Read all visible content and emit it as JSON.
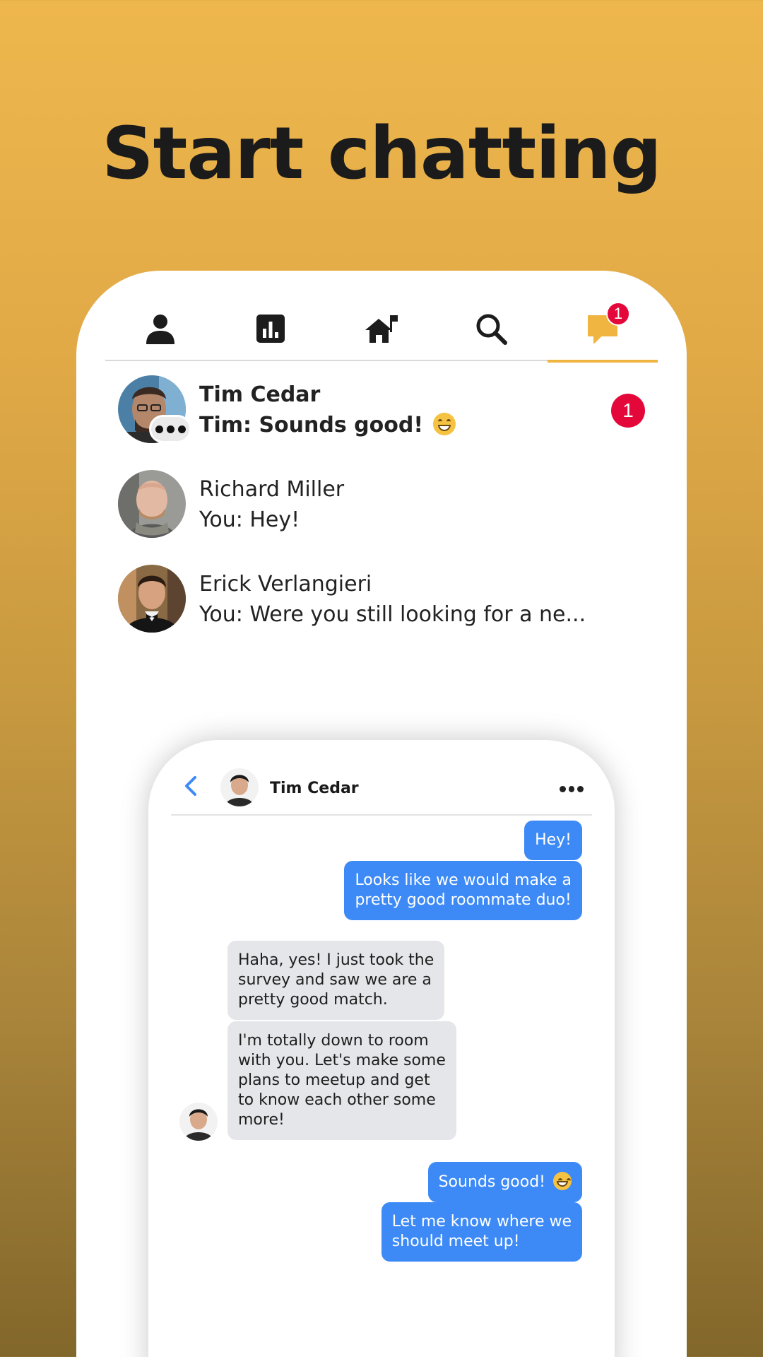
{
  "headline": "Start chatting",
  "colors": {
    "accent": "#f0b540",
    "badge": "#e4083a",
    "outgoing_bubble": "#3d8af7",
    "incoming_bubble": "#e5e6ea"
  },
  "tabs": [
    {
      "icon": "person-icon",
      "active": false
    },
    {
      "icon": "stats-icon",
      "active": false
    },
    {
      "icon": "home-icon",
      "active": false
    },
    {
      "icon": "search-icon",
      "active": false
    },
    {
      "icon": "chat-icon",
      "active": true,
      "badge": "1"
    }
  ],
  "conversations": [
    {
      "name": "Tim Cedar",
      "message": "Tim: Sounds good!",
      "unread": "1",
      "typing": true
    },
    {
      "name": "Richard Miller",
      "message": "You: Hey!"
    },
    {
      "name": "Erick Verlangieri",
      "message": "You: Were you still looking for a ne..."
    }
  ],
  "chat": {
    "contact_name": "Tim Cedar",
    "messages": [
      {
        "from": "me",
        "text": "Hey!"
      },
      {
        "from": "me",
        "text": "Looks like we would make a\npretty good roommate duo!"
      },
      {
        "from": "them",
        "text": "Haha, yes! I just took the\nsurvey and saw we are a\npretty good match."
      },
      {
        "from": "them",
        "text": "I'm totally down to room\nwith you. Let's make some\nplans to meetup and get\nto know each other some\nmore!"
      },
      {
        "from": "me",
        "text": "Sounds good!"
      },
      {
        "from": "me",
        "text": "Let me know where we\nshould meet up!"
      }
    ]
  }
}
